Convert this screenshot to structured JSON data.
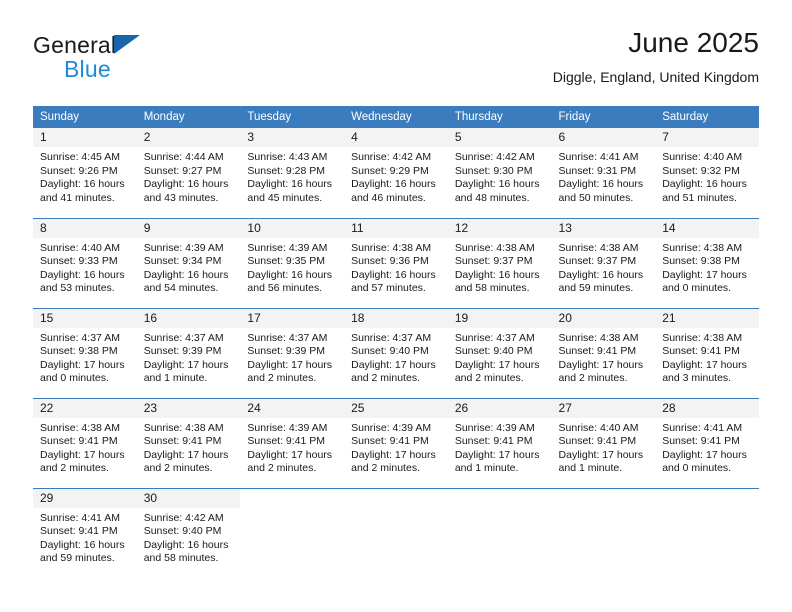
{
  "brand": {
    "name_top": "General",
    "name_bottom": "Blue",
    "triangle_color": "#1665ad",
    "blue_color": "#1c8adb"
  },
  "header": {
    "title": "June 2025",
    "subtitle": "Diggle, England, United Kingdom"
  },
  "theme": {
    "header_row_bg": "#3b7cbf",
    "daynum_bg": "#f3f3f3",
    "grid_line": "#3b7cbf",
    "text": "#1a1a1a"
  },
  "weekday_headers": [
    "Sunday",
    "Monday",
    "Tuesday",
    "Wednesday",
    "Thursday",
    "Friday",
    "Saturday"
  ],
  "labels": {
    "sunrise": "Sunrise:",
    "sunset": "Sunset:",
    "daylight": "Daylight:"
  },
  "weeks": [
    [
      {
        "day": "1",
        "sunrise": "Sunrise: 4:45 AM",
        "sunset": "Sunset: 9:26 PM",
        "daylight": "Daylight: 16 hours and 41 minutes."
      },
      {
        "day": "2",
        "sunrise": "Sunrise: 4:44 AM",
        "sunset": "Sunset: 9:27 PM",
        "daylight": "Daylight: 16 hours and 43 minutes."
      },
      {
        "day": "3",
        "sunrise": "Sunrise: 4:43 AM",
        "sunset": "Sunset: 9:28 PM",
        "daylight": "Daylight: 16 hours and 45 minutes."
      },
      {
        "day": "4",
        "sunrise": "Sunrise: 4:42 AM",
        "sunset": "Sunset: 9:29 PM",
        "daylight": "Daylight: 16 hours and 46 minutes."
      },
      {
        "day": "5",
        "sunrise": "Sunrise: 4:42 AM",
        "sunset": "Sunset: 9:30 PM",
        "daylight": "Daylight: 16 hours and 48 minutes."
      },
      {
        "day": "6",
        "sunrise": "Sunrise: 4:41 AM",
        "sunset": "Sunset: 9:31 PM",
        "daylight": "Daylight: 16 hours and 50 minutes."
      },
      {
        "day": "7",
        "sunrise": "Sunrise: 4:40 AM",
        "sunset": "Sunset: 9:32 PM",
        "daylight": "Daylight: 16 hours and 51 minutes."
      }
    ],
    [
      {
        "day": "8",
        "sunrise": "Sunrise: 4:40 AM",
        "sunset": "Sunset: 9:33 PM",
        "daylight": "Daylight: 16 hours and 53 minutes."
      },
      {
        "day": "9",
        "sunrise": "Sunrise: 4:39 AM",
        "sunset": "Sunset: 9:34 PM",
        "daylight": "Daylight: 16 hours and 54 minutes."
      },
      {
        "day": "10",
        "sunrise": "Sunrise: 4:39 AM",
        "sunset": "Sunset: 9:35 PM",
        "daylight": "Daylight: 16 hours and 56 minutes."
      },
      {
        "day": "11",
        "sunrise": "Sunrise: 4:38 AM",
        "sunset": "Sunset: 9:36 PM",
        "daylight": "Daylight: 16 hours and 57 minutes."
      },
      {
        "day": "12",
        "sunrise": "Sunrise: 4:38 AM",
        "sunset": "Sunset: 9:37 PM",
        "daylight": "Daylight: 16 hours and 58 minutes."
      },
      {
        "day": "13",
        "sunrise": "Sunrise: 4:38 AM",
        "sunset": "Sunset: 9:37 PM",
        "daylight": "Daylight: 16 hours and 59 minutes."
      },
      {
        "day": "14",
        "sunrise": "Sunrise: 4:38 AM",
        "sunset": "Sunset: 9:38 PM",
        "daylight": "Daylight: 17 hours and 0 minutes."
      }
    ],
    [
      {
        "day": "15",
        "sunrise": "Sunrise: 4:37 AM",
        "sunset": "Sunset: 9:38 PM",
        "daylight": "Daylight: 17 hours and 0 minutes."
      },
      {
        "day": "16",
        "sunrise": "Sunrise: 4:37 AM",
        "sunset": "Sunset: 9:39 PM",
        "daylight": "Daylight: 17 hours and 1 minute."
      },
      {
        "day": "17",
        "sunrise": "Sunrise: 4:37 AM",
        "sunset": "Sunset: 9:39 PM",
        "daylight": "Daylight: 17 hours and 2 minutes."
      },
      {
        "day": "18",
        "sunrise": "Sunrise: 4:37 AM",
        "sunset": "Sunset: 9:40 PM",
        "daylight": "Daylight: 17 hours and 2 minutes."
      },
      {
        "day": "19",
        "sunrise": "Sunrise: 4:37 AM",
        "sunset": "Sunset: 9:40 PM",
        "daylight": "Daylight: 17 hours and 2 minutes."
      },
      {
        "day": "20",
        "sunrise": "Sunrise: 4:38 AM",
        "sunset": "Sunset: 9:41 PM",
        "daylight": "Daylight: 17 hours and 2 minutes."
      },
      {
        "day": "21",
        "sunrise": "Sunrise: 4:38 AM",
        "sunset": "Sunset: 9:41 PM",
        "daylight": "Daylight: 17 hours and 3 minutes."
      }
    ],
    [
      {
        "day": "22",
        "sunrise": "Sunrise: 4:38 AM",
        "sunset": "Sunset: 9:41 PM",
        "daylight": "Daylight: 17 hours and 2 minutes."
      },
      {
        "day": "23",
        "sunrise": "Sunrise: 4:38 AM",
        "sunset": "Sunset: 9:41 PM",
        "daylight": "Daylight: 17 hours and 2 minutes."
      },
      {
        "day": "24",
        "sunrise": "Sunrise: 4:39 AM",
        "sunset": "Sunset: 9:41 PM",
        "daylight": "Daylight: 17 hours and 2 minutes."
      },
      {
        "day": "25",
        "sunrise": "Sunrise: 4:39 AM",
        "sunset": "Sunset: 9:41 PM",
        "daylight": "Daylight: 17 hours and 2 minutes."
      },
      {
        "day": "26",
        "sunrise": "Sunrise: 4:39 AM",
        "sunset": "Sunset: 9:41 PM",
        "daylight": "Daylight: 17 hours and 1 minute."
      },
      {
        "day": "27",
        "sunrise": "Sunrise: 4:40 AM",
        "sunset": "Sunset: 9:41 PM",
        "daylight": "Daylight: 17 hours and 1 minute."
      },
      {
        "day": "28",
        "sunrise": "Sunrise: 4:41 AM",
        "sunset": "Sunset: 9:41 PM",
        "daylight": "Daylight: 17 hours and 0 minutes."
      }
    ],
    [
      {
        "day": "29",
        "sunrise": "Sunrise: 4:41 AM",
        "sunset": "Sunset: 9:41 PM",
        "daylight": "Daylight: 16 hours and 59 minutes."
      },
      {
        "day": "30",
        "sunrise": "Sunrise: 4:42 AM",
        "sunset": "Sunset: 9:40 PM",
        "daylight": "Daylight: 16 hours and 58 minutes."
      },
      {
        "day": "",
        "sunrise": "",
        "sunset": "",
        "daylight": ""
      },
      {
        "day": "",
        "sunrise": "",
        "sunset": "",
        "daylight": ""
      },
      {
        "day": "",
        "sunrise": "",
        "sunset": "",
        "daylight": ""
      },
      {
        "day": "",
        "sunrise": "",
        "sunset": "",
        "daylight": ""
      },
      {
        "day": "",
        "sunrise": "",
        "sunset": "",
        "daylight": ""
      }
    ]
  ]
}
